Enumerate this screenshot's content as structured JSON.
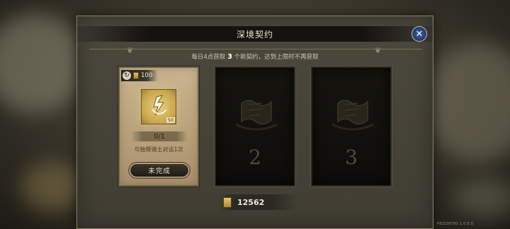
{
  "dialog": {
    "title": "深境契约",
    "subtitle_prefix": "每日4点获取 ",
    "subtitle_count": "3",
    "subtitle_suffix": " 个新契约，达到上限时不再获取"
  },
  "cards": [
    {
      "cost": "100",
      "reward_count": "50",
      "progress": "0/1",
      "task": "与独臂骑士对话1次",
      "status_label": "未完成"
    },
    {
      "slot_number": "2"
    },
    {
      "slot_number": "3"
    }
  ],
  "currency": {
    "value": "12562"
  },
  "footer": {
    "version": "PID328791 1.0.5.0"
  },
  "colors": {
    "accent_gold": "#c9a64a",
    "close_button_blue": "#3d62a8"
  },
  "icons": {
    "close": "close-icon",
    "refresh": "refresh-icon",
    "scroll": "scroll-icon",
    "reward": "contract-glyph-icon",
    "locked": "scroll-emblem-icon"
  }
}
